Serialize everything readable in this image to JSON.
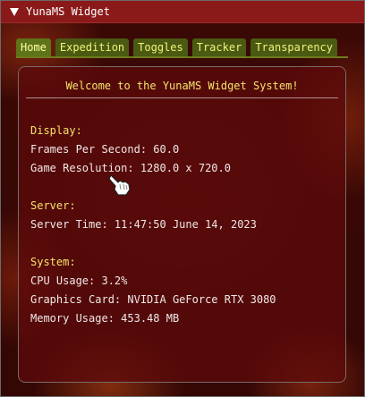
{
  "window": {
    "title": "YunaMS Widget"
  },
  "tabs": [
    {
      "label": "Home"
    },
    {
      "label": "Expedition"
    },
    {
      "label": "Toggles"
    },
    {
      "label": "Tracker"
    },
    {
      "label": "Transparency"
    }
  ],
  "home": {
    "welcome": "Welcome to the YunaMS Widget System!",
    "display": {
      "heading": "Display:",
      "fps": "Frames Per Second: 60.0",
      "resolution": "Game Resolution: 1280.0 x 720.0"
    },
    "server": {
      "heading": "Server:",
      "time": "Server Time: 11:47:50 June 14, 2023"
    },
    "system": {
      "heading": "System:",
      "cpu": "CPU Usage: 3.2%",
      "gpu": "Graphics Card: NVIDIA GeForce RTX 3080",
      "memory": "Memory Usage: 453.48 MB"
    }
  },
  "colors": {
    "title_bar": "#8a1a1a",
    "tab_bg": "#4a5a12",
    "tab_text": "#f2f27a",
    "heading_text": "#f6e36a"
  },
  "icons": {
    "collapse": "triangle-down-icon",
    "cursor": "hand-pointer-icon"
  }
}
